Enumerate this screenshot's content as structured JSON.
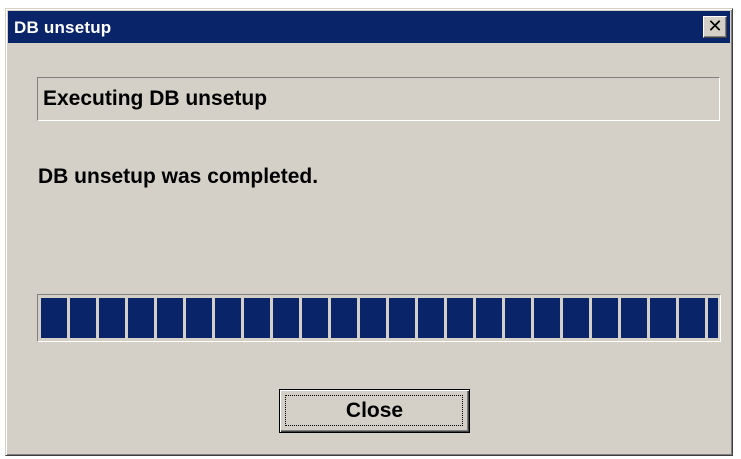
{
  "window": {
    "title": "DB unsetup",
    "close_glyph": "✕"
  },
  "status_box": {
    "text": "Executing DB unsetup"
  },
  "message": "DB unsetup was completed.",
  "progress": {
    "percent": 100,
    "fill_color": "#0a246a"
  },
  "buttons": {
    "close_label": "Close"
  },
  "colors": {
    "titlebar": "#0a246a",
    "dialog_background": "#d4d0c8"
  }
}
